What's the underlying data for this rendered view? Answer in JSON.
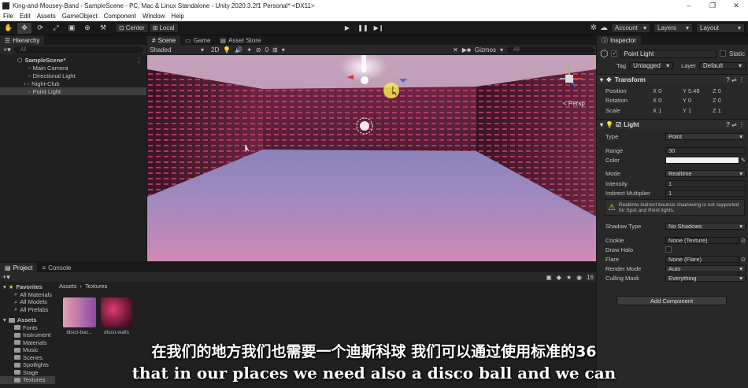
{
  "window": {
    "title": "King-and-Mousey-Band - SampleScene - PC, Mac & Linux Standalone - Unity 2020.3.2f1 Personal* <DX11>",
    "controls": [
      "–",
      "❐",
      "✕"
    ]
  },
  "menu": [
    "File",
    "Edit",
    "Assets",
    "GameObject",
    "Component",
    "Window",
    "Help"
  ],
  "toolbar": {
    "pivot": "Center",
    "space": "Local",
    "account": "Account",
    "layers": "Layers",
    "layout": "Layout"
  },
  "hierarchy": {
    "tab": "Hierarchy",
    "search_placeholder": "All",
    "items": [
      {
        "label": "SampleScene*",
        "badge": "⋮"
      },
      {
        "label": "Main Camera"
      },
      {
        "label": "Directional Light"
      },
      {
        "label": "Night-Club"
      },
      {
        "label": "Point Light"
      }
    ]
  },
  "scene": {
    "tabs": [
      "Scene",
      "Game",
      "Asset Store"
    ],
    "shading": "Shaded",
    "mode_2d": "2D",
    "effects_count": "0",
    "gizmos": "Gizmos",
    "search_placeholder": "All",
    "persp": "< Persp"
  },
  "project": {
    "tabs": [
      "Project",
      "Console"
    ],
    "favorites_label": "Favorites",
    "favorites": [
      "All Materials",
      "All Models",
      "All Prefabs"
    ],
    "assets_label": "Assets",
    "folders": [
      "Fonts",
      "Instrument",
      "Materials",
      "Music",
      "Scenes",
      "Spotlights",
      "Stage",
      "Textures"
    ],
    "breadcrumb": [
      "Assets",
      "Textures"
    ],
    "thumbnails": [
      {
        "label": "disco-bac..."
      },
      {
        "label": "disco-walls"
      }
    ],
    "slider_value": "16"
  },
  "inspector": {
    "tab": "Inspector",
    "object_name": "Point Light",
    "static_label": "Static",
    "tag_label": "Tag",
    "tag_value": "Untagged",
    "layer_label": "Layer",
    "layer_value": "Default",
    "transform": {
      "title": "Transform",
      "rows": [
        {
          "label": "Position",
          "x": "0",
          "y": "5.48",
          "z": "0"
        },
        {
          "label": "Rotation",
          "x": "0",
          "y": "0",
          "z": "0"
        },
        {
          "label": "Scale",
          "x": "1",
          "y": "1",
          "z": "1"
        }
      ]
    },
    "light": {
      "title": "Light",
      "type_label": "Type",
      "type_value": "Point",
      "range_label": "Range",
      "range_value": "30",
      "color_label": "Color",
      "mode_label": "Mode",
      "mode_value": "Realtime",
      "intensity_label": "Intensity",
      "intensity_value": "1",
      "indirect_label": "Indirect Multiplier",
      "indirect_value": "1",
      "warning": "Realtime indirect bounce shadowing is not supported for Spot and Point lights.",
      "shadow_label": "Shadow Type",
      "shadow_value": "No Shadows",
      "cookie_label": "Cookie",
      "cookie_value": "None (Texture)",
      "halo_label": "Draw Halo",
      "flare_label": "Flare",
      "flare_value": "None (Flare)",
      "render_label": "Render Mode",
      "render_value": "Auto",
      "culling_label": "Culling Mask",
      "culling_value": "Everything"
    },
    "add_component": "Add Component"
  },
  "subtitles": {
    "chinese": "在我们的地方我们也需要一个迪斯科球 我们可以通过使用标准的36",
    "english": "that in our places we need also a disco ball and we can"
  },
  "colors": {
    "accent": "#3a72b0",
    "panel": "#202020",
    "viewport_wall": "#7a2a4a",
    "floor": "#8e7aa6"
  }
}
